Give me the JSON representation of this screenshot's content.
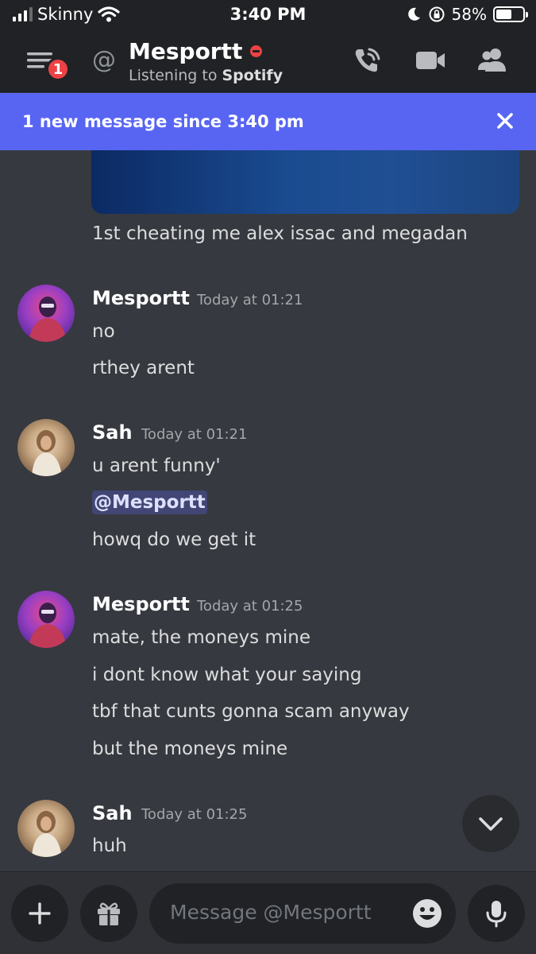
{
  "status_bar": {
    "carrier": "Skinny",
    "time": "3:40 PM",
    "battery": "58%",
    "battery_level": 0.58
  },
  "header": {
    "unread_count": "1",
    "name": "Mesportt",
    "status_prefix": "Listening to",
    "status_app": "Spotify"
  },
  "banner": {
    "text": "1 new message since 3:40 pm"
  },
  "messages": {
    "caption": "1st cheating me alex issac and megadan",
    "groups": [
      {
        "author": "Mesportt",
        "time": "Today at 01:21",
        "lines": [
          "no",
          "rthey arent"
        ]
      },
      {
        "author": "Sah",
        "time": "Today at 01:21",
        "lines": [
          "u arent funny'",
          "@Mesportt",
          "howq do we get it"
        ]
      },
      {
        "author": "Mesportt",
        "time": "Today at 01:25",
        "lines": [
          "mate, the moneys mine",
          "i dont know what your saying",
          "tbf that cunts gonna scam anyway",
          "but the moneys mine"
        ]
      },
      {
        "author": "Sah",
        "time": "Today at 01:25",
        "lines": [
          "huh"
        ]
      }
    ]
  },
  "composer": {
    "placeholder": "Message @Mesportt"
  },
  "colors": {
    "background": "#36393f",
    "header": "#202225",
    "blurple": "#5865f2",
    "dnd_red": "#ed4245",
    "mention_bg": "#414675"
  },
  "icons": [
    "menu-icon",
    "at-icon",
    "dnd-status-icon",
    "voice-call-icon",
    "video-call-icon",
    "members-icon",
    "close-icon",
    "chevron-down-icon",
    "plus-icon",
    "gift-icon",
    "emoji-icon",
    "microphone-icon"
  ]
}
